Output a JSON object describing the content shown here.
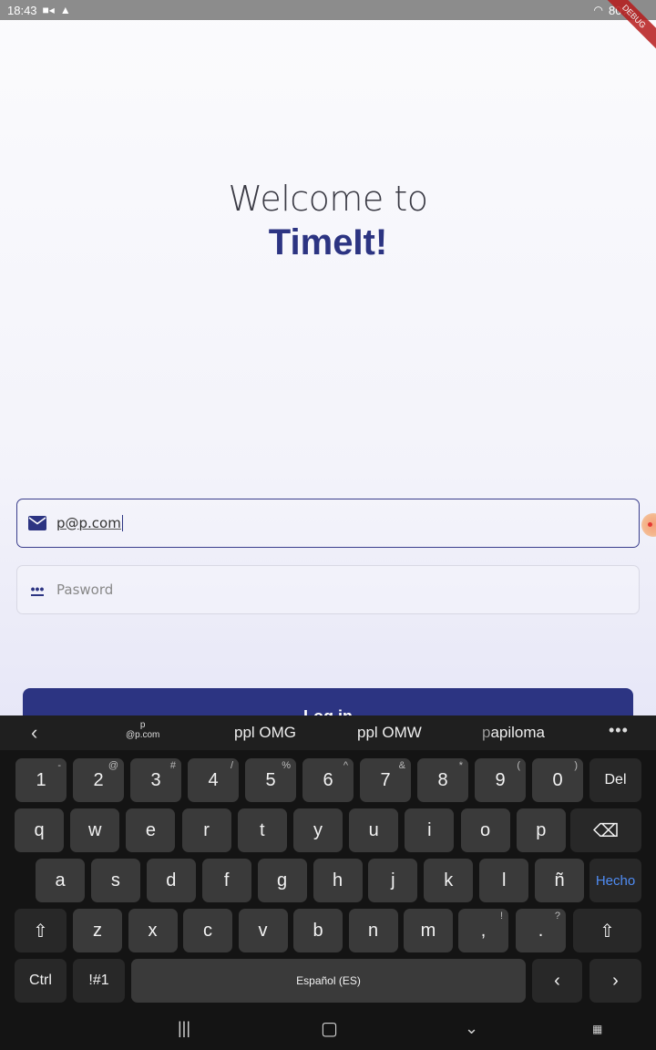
{
  "status": {
    "time": "18:43",
    "battery": "80%",
    "debug_label": "DEBUG"
  },
  "welcome": {
    "line1": "Welcome to",
    "app_name": "TimeIt!"
  },
  "email_field": {
    "value": "p@p.com",
    "icon": "mail-icon"
  },
  "password_field": {
    "placeholder": "Pasword",
    "icon": "password-dots-icon"
  },
  "login_button": {
    "label": "Log in"
  },
  "keyboard": {
    "suggestions": {
      "first_top": "p",
      "first_bottom": "@p.com",
      "second": "ppl OMG",
      "third": "ppl OMW",
      "fourth_prefix": "p",
      "fourth_rest": "apiloma"
    },
    "row1": [
      {
        "k": "1",
        "s": "-"
      },
      {
        "k": "2",
        "s": "@"
      },
      {
        "k": "3",
        "s": "#"
      },
      {
        "k": "4",
        "s": "/"
      },
      {
        "k": "5",
        "s": "%"
      },
      {
        "k": "6",
        "s": "^"
      },
      {
        "k": "7",
        "s": "&"
      },
      {
        "k": "8",
        "s": "*"
      },
      {
        "k": "9",
        "s": "("
      },
      {
        "k": "0",
        "s": ")"
      }
    ],
    "del_label": "Del",
    "row2": [
      "q",
      "w",
      "e",
      "r",
      "t",
      "y",
      "u",
      "i",
      "o",
      "p"
    ],
    "row3": [
      "a",
      "s",
      "d",
      "f",
      "g",
      "h",
      "j",
      "k",
      "l",
      "ñ"
    ],
    "hecho_label": "Hecho",
    "row4": [
      "z",
      "x",
      "c",
      "v",
      "b",
      "n",
      "m"
    ],
    "comma": ",",
    "comma_sup": "!",
    "period": ".",
    "period_sup": "?",
    "ctrl_label": "Ctrl",
    "sym_label": "!#1",
    "space_label": "Español (ES)"
  }
}
